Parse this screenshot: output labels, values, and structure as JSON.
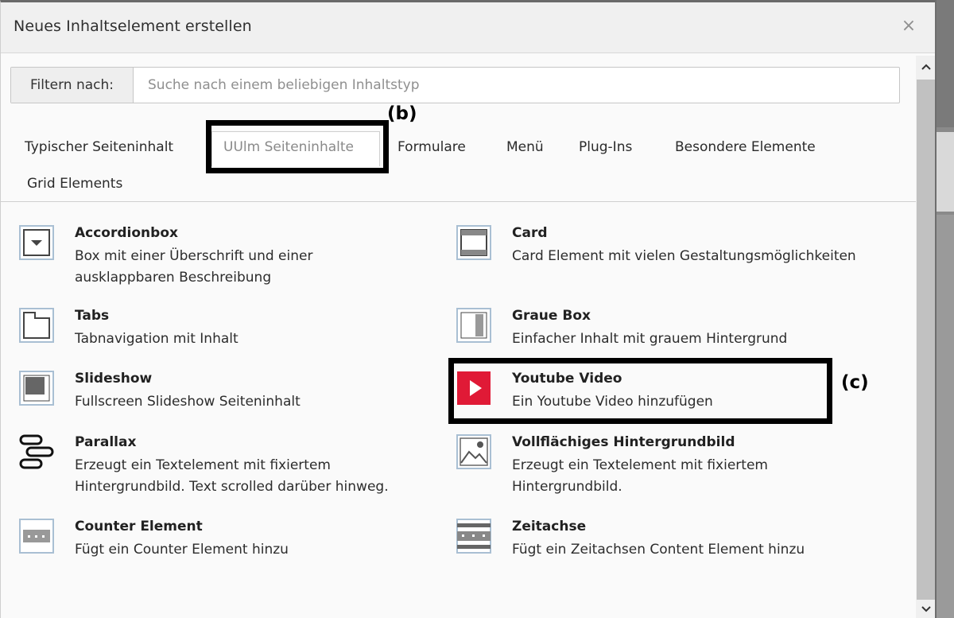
{
  "dialog": {
    "title": "Neues Inhaltselement erstellen",
    "close_symbol": "×"
  },
  "filter": {
    "label": "Filtern nach:",
    "placeholder": "Suche nach einem beliebigen Inhaltstyp"
  },
  "tabs": [
    {
      "label": "Typischer Seiteninhalt",
      "active": false
    },
    {
      "label": "UUlm Seiteninhalte",
      "active": true
    },
    {
      "label": "Formulare",
      "active": false
    },
    {
      "label": "Menü",
      "active": false
    },
    {
      "label": "Plug-Ins",
      "active": false
    },
    {
      "label": "Besondere Elemente",
      "active": false
    },
    {
      "label": "Grid Elements",
      "active": false
    }
  ],
  "annotations": {
    "b": "(b)",
    "c": "(c)"
  },
  "elements": [
    {
      "title": "Accordionbox",
      "desc1": "Box mit einer Überschrift und einer",
      "desc2": "ausklappbaren Beschreibung",
      "icon": "accordion-icon"
    },
    {
      "title": "Card",
      "desc1": "Card Element mit vielen Gestaltungsmöglichkeiten",
      "desc2": "",
      "icon": "card-icon"
    },
    {
      "title": "Tabs",
      "desc1": "Tabnavigation mit Inhalt",
      "desc2": "",
      "icon": "tabs-icon"
    },
    {
      "title": "Graue Box",
      "desc1": "Einfacher Inhalt mit grauem Hintergrund",
      "desc2": "",
      "icon": "grey-box-icon"
    },
    {
      "title": "Slideshow",
      "desc1": "Fullscreen Slideshow Seiteninhalt",
      "desc2": "",
      "icon": "slideshow-icon"
    },
    {
      "title": "Youtube Video",
      "desc1": "Ein Youtube Video hinzufügen",
      "desc2": "",
      "icon": "youtube-icon"
    },
    {
      "title": "Parallax",
      "desc1": "Erzeugt ein Textelement mit fixiertem",
      "desc2": "Hintergrundbild. Text scrolled darüber hinweg.",
      "icon": "parallax-icon"
    },
    {
      "title": "Vollflächiges Hintergrundbild",
      "desc1": "Erzeugt ein Textelement mit fixiertem",
      "desc2": "Hintergrundbild.",
      "icon": "background-image-icon"
    },
    {
      "title": "Counter Element",
      "desc1": "Fügt ein Counter Element hinzu",
      "desc2": "",
      "icon": "counter-icon"
    },
    {
      "title": "Zeitachse",
      "desc1": "Fügt ein Zeitachsen Content Element hinzu",
      "desc2": "",
      "icon": "timeline-icon"
    }
  ],
  "colors": {
    "youtube_red": "#e01a36",
    "icon_border": "#7f9fbf",
    "annotation": "#000000"
  }
}
